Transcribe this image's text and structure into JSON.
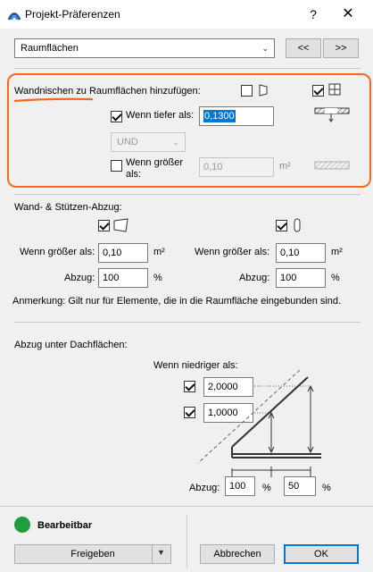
{
  "window": {
    "title": "Projekt-Präferenzen",
    "help": "?",
    "close": "✕"
  },
  "top": {
    "dropdown_value": "Raumflächen",
    "prev": "<<",
    "next": ">>"
  },
  "wall_niches": {
    "header": "Wandnischen zu Raumflächen hinzufügen:",
    "deeper_label": "Wenn tiefer als:",
    "deeper_value": "0,1300",
    "operator": "UND",
    "larger_label": "Wenn größer als:",
    "larger_value": "0,10",
    "larger_unit": "m²"
  },
  "wall_column": {
    "header": "Wand- & Stützen-Abzug:",
    "left": {
      "larger_label": "Wenn größer als:",
      "larger_value": "0,10",
      "larger_unit": "m²",
      "abzug_label": "Abzug:",
      "abzug_value": "100",
      "abzug_unit": "%"
    },
    "right": {
      "larger_label": "Wenn größer als:",
      "larger_value": "0,10",
      "larger_unit": "m²",
      "abzug_label": "Abzug:",
      "abzug_value": "100",
      "abzug_unit": "%"
    },
    "note": "Anmerkung: Gilt nur für Elemente, die in die Raumfläche eingebunden sind."
  },
  "roof": {
    "header": "Abzug unter Dachflächen:",
    "lower_label": "Wenn niedriger als:",
    "height1": "2,0000",
    "height2": "1,0000",
    "abzug_label": "Abzug:",
    "abzug1": "100",
    "abzug2": "50",
    "pct": "%"
  },
  "footer": {
    "status": "Bearbeitbar",
    "status_color": "#1e9e3e",
    "share_button": "Freigeben",
    "cancel_button": "Abbrechen",
    "ok_button": "OK"
  }
}
